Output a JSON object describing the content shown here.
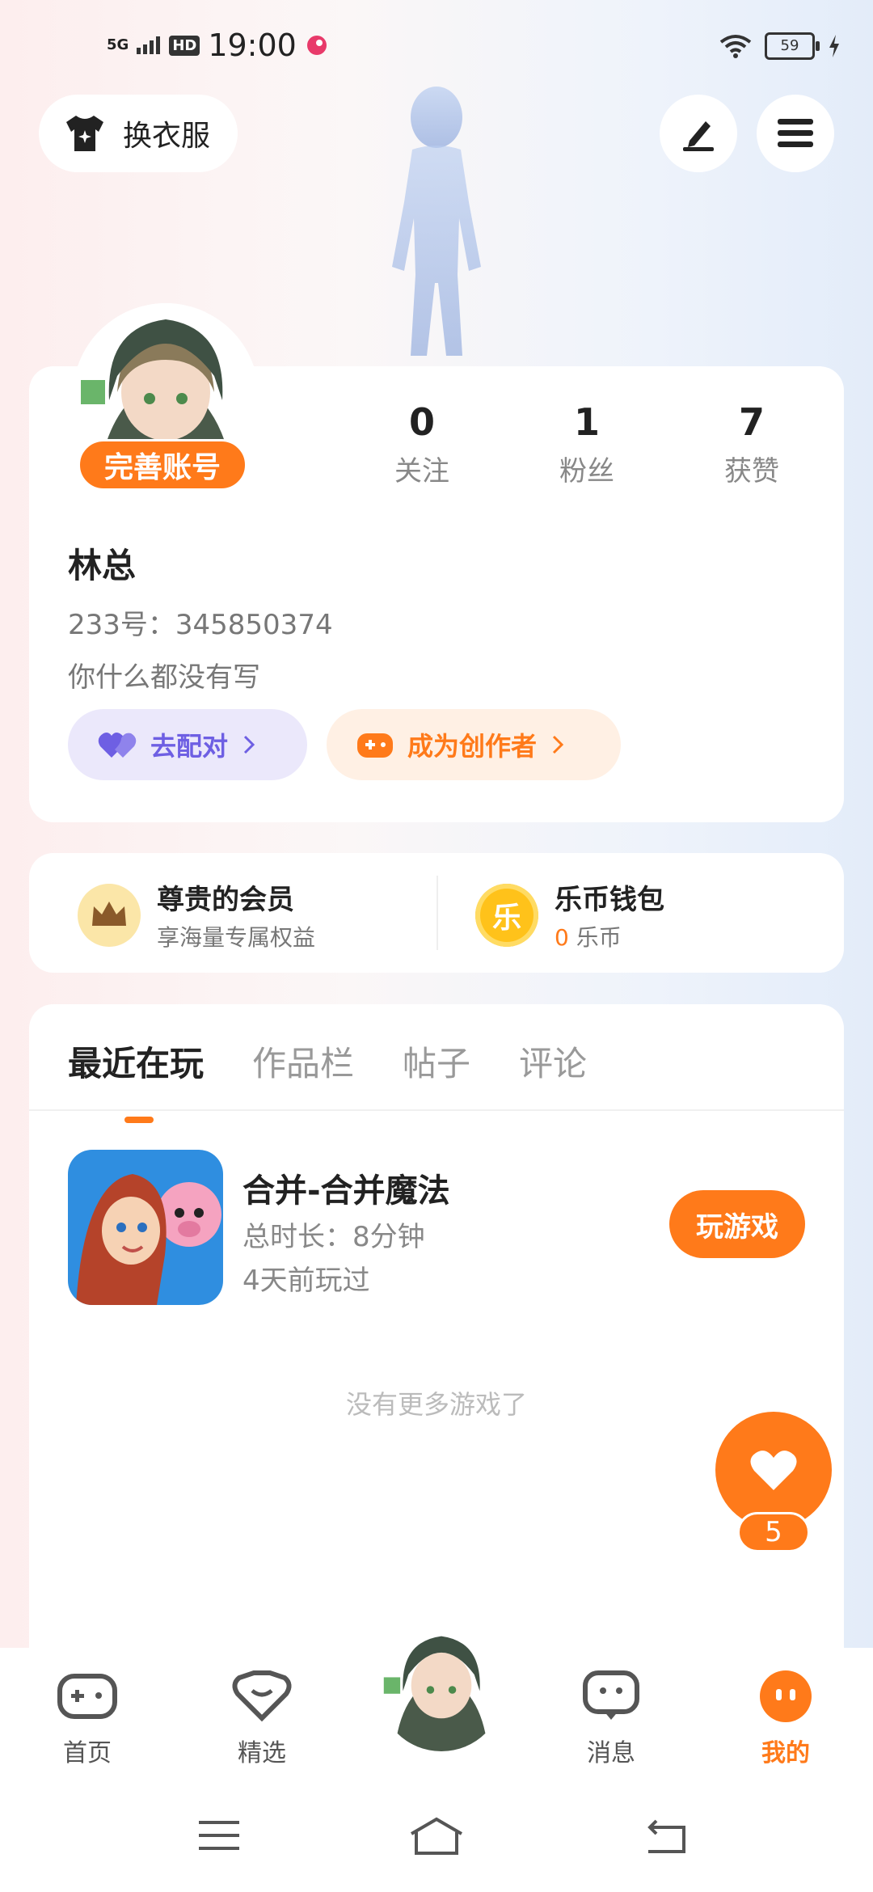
{
  "status_bar": {
    "network": "5G",
    "hd": "HD",
    "time": "19:00",
    "battery": "59"
  },
  "top": {
    "change_clothes": "换衣服"
  },
  "profile": {
    "complete_account": "完善账号",
    "stats": [
      {
        "value": "0",
        "label": "关注"
      },
      {
        "value": "1",
        "label": "粉丝"
      },
      {
        "value": "7",
        "label": "获赞"
      }
    ],
    "name": "林总",
    "uid": "233号：345850374",
    "bio": "你什么都没有写",
    "pair_button": "去配对",
    "creator_button": "成为创作者"
  },
  "vip": {
    "member_title": "尊贵的会员",
    "member_sub": "享海量专属权益",
    "wallet_title": "乐币钱包",
    "wallet_amount": "0",
    "wallet_unit": "乐币",
    "coin_glyph": "乐"
  },
  "tabs": [
    "最近在玩",
    "作品栏",
    "帖子",
    "评论"
  ],
  "recent_game": {
    "name": "合并-合并魔法",
    "total_time": "总时长：8分钟",
    "last_played": "4天前玩过",
    "play_button": "玩游戏"
  },
  "empty_text": "没有更多游戏了",
  "like_count": "5",
  "nav": [
    {
      "label": "首页",
      "icon": "gamepad-icon"
    },
    {
      "label": "精选",
      "icon": "heart-outline-icon"
    },
    {
      "label": "消息",
      "icon": "chat-icon"
    },
    {
      "label": "我的",
      "icon": "face-icon"
    }
  ],
  "colors": {
    "accent": "#ff7a1a",
    "pair": "#6e5fe3"
  }
}
